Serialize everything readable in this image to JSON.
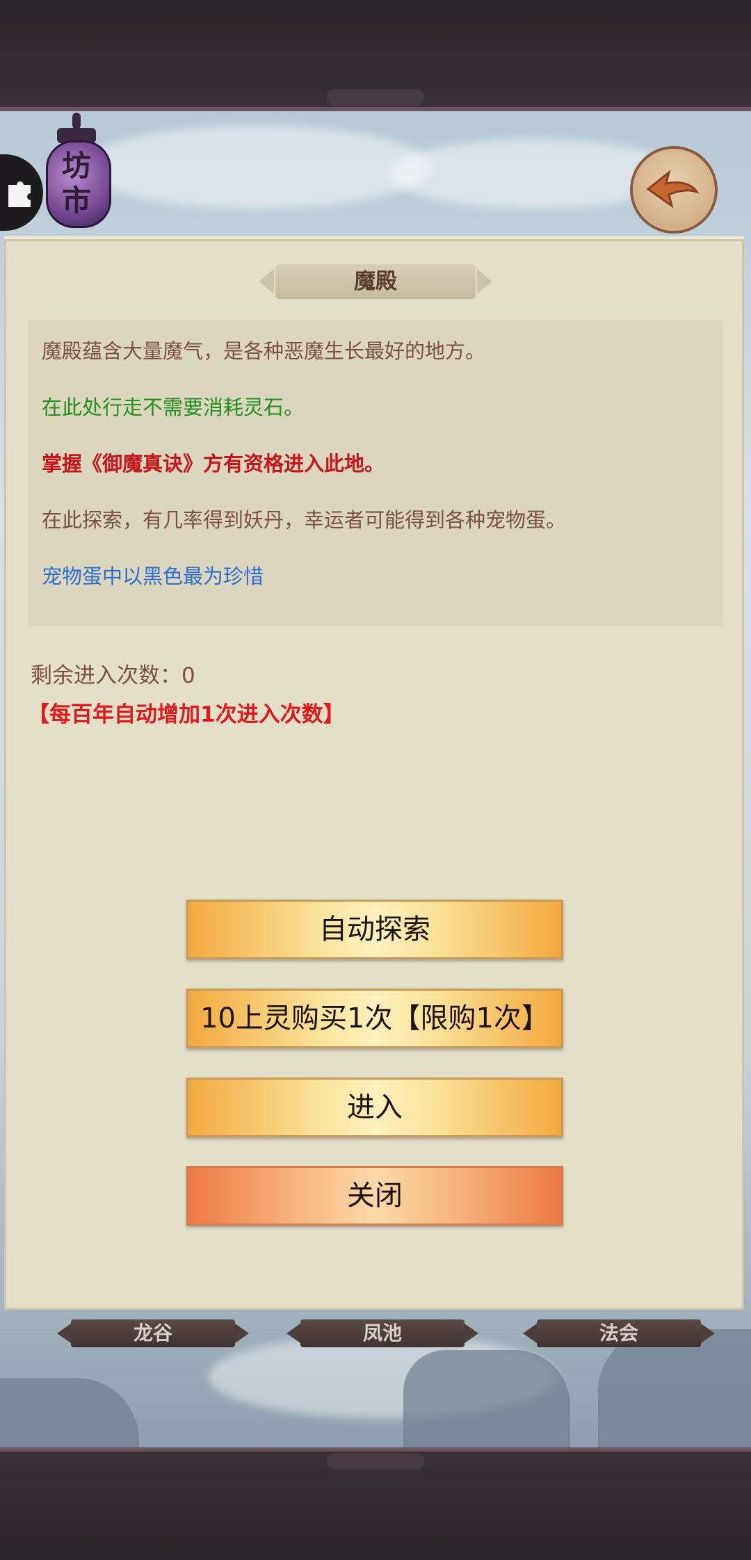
{
  "header": {
    "lantern_text": "坊市",
    "back_icon": "back-arrow-icon",
    "side_icon": "puzzle-icon"
  },
  "panel": {
    "title": "魔殿",
    "descriptions": [
      {
        "text": "魔殿蕴含大量魔气，是各种恶魔生长最好的地方。",
        "color": "#7a5340"
      },
      {
        "text": "在此处行走不需要消耗灵石。",
        "color": "#23901f"
      },
      {
        "text": "掌握《御魔真诀》方有资格进入此地。",
        "color": "#c6161a"
      },
      {
        "text": "在此探索，有几率得到妖丹，幸运者可能得到各种宠物蛋。",
        "color": "#7a5340"
      },
      {
        "text": "宠物蛋中以黑色最为珍惜",
        "color": "#2b6fd0"
      }
    ],
    "remaining": "剩余进入次数：0",
    "notice": "【每百年自动增加1次进入次数】"
  },
  "buttons": {
    "auto_explore": "自动探索",
    "buy": "10上灵购买1次【限购1次】",
    "enter": "进入",
    "close": "关闭"
  },
  "bottom_nav": [
    "龙谷",
    "凤池",
    "法会"
  ]
}
